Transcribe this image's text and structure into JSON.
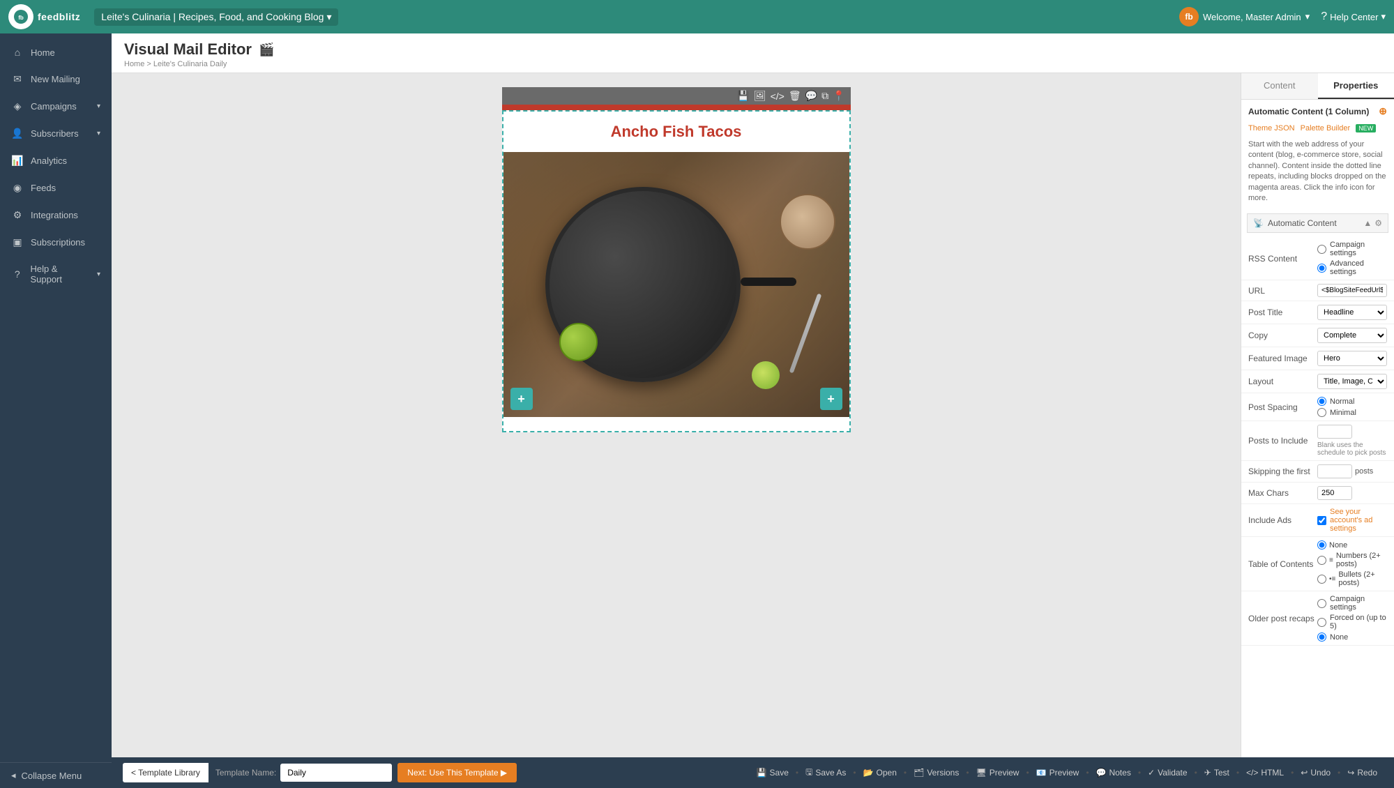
{
  "topnav": {
    "logo_text": "feedblitz",
    "logo_initials": "fb",
    "blog_name": "Leite's Culinaria | Recipes, Food, and Cooking Blog",
    "welcome_text": "Welcome, Master Admin",
    "help_text": "Help Center"
  },
  "sidebar": {
    "items": [
      {
        "id": "home",
        "label": "Home",
        "icon": "🏠"
      },
      {
        "id": "new-mailing",
        "label": "New Mailing",
        "icon": "✉"
      },
      {
        "id": "campaigns",
        "label": "Campaigns",
        "icon": "📢",
        "arrow": true
      },
      {
        "id": "subscribers",
        "label": "Subscribers",
        "icon": "👥",
        "arrow": true
      },
      {
        "id": "analytics",
        "label": "Analytics",
        "icon": "📊"
      },
      {
        "id": "feeds",
        "label": "Feeds",
        "icon": "📡"
      },
      {
        "id": "integrations",
        "label": "Integrations",
        "icon": "🔗"
      },
      {
        "id": "subscriptions",
        "label": "Subscriptions",
        "icon": "💳"
      },
      {
        "id": "help",
        "label": "Help & Support",
        "icon": "❓",
        "arrow": true
      }
    ],
    "collapse_label": "Collapse Menu"
  },
  "page": {
    "title": "Visual Mail Editor",
    "breadcrumb_home": "Home",
    "breadcrumb_sep": ">",
    "breadcrumb_current": "Leite's Culinaria Daily"
  },
  "email_content": {
    "post_title": "Ancho Fish Tacos"
  },
  "properties": {
    "tab_content": "Content",
    "tab_properties": "Properties",
    "section_title": "Automatic Content (1 Column)",
    "theme_json_label": "Theme JSON",
    "palette_builder_label": "Palette Builder",
    "palette_builder_badge": "NEW",
    "description": "Start with the web address of your content (blog, e-commerce store, social channel). Content inside the dotted line repeats, including blocks dropped on the magenta areas. Click the info icon for more.",
    "auto_content_label": "Automatic Content",
    "url_label": "URL",
    "url_value": "<$BlogSiteFeedUrl$>",
    "post_title_label": "Post Title",
    "post_title_value": "Headline",
    "copy_label": "Copy",
    "copy_value": "Complete",
    "featured_image_label": "Featured Image",
    "featured_image_value": "Hero",
    "layout_label": "Layout",
    "layout_value": "Title, Image, Copy",
    "post_spacing_label": "Post Spacing",
    "post_spacing_normal": "Normal",
    "post_spacing_minimal": "Minimal",
    "posts_to_include_label": "Posts to Include",
    "posts_to_include_placeholder": "",
    "posts_to_include_hint": "Blank uses the schedule to pick posts",
    "skipping_first_label": "Skipping the first",
    "posts_suffix": "posts",
    "max_chars_label": "Max Chars",
    "max_chars_value": "250",
    "include_ads_label": "Include Ads",
    "include_ads_link": "See your account's ad settings",
    "table_of_contents_label": "Table of Contents",
    "toc_none": "None",
    "toc_numbers": "Numbers (2+ posts)",
    "toc_bullets": "Bullets (2+ posts)",
    "older_post_recaps_label": "Older post recaps",
    "recaps_campaign": "Campaign settings",
    "recaps_forced": "Forced on (up to 5)",
    "recaps_none": "None",
    "rss_content_label": "RSS Content",
    "rss_campaign": "Campaign settings",
    "rss_advanced": "Advanced settings"
  },
  "bottom_bar": {
    "template_lib_btn": "< Template Library",
    "template_name_label": "Template Name:",
    "template_name_value": "Daily",
    "use_template_btn": "Next: Use This Template ▶",
    "actions": [
      "Save",
      "Save As",
      "Open",
      "Versions",
      "Preview",
      "Preview",
      "Notes",
      "Validate",
      "Test",
      "HTML",
      "Undo",
      "Redo"
    ]
  }
}
